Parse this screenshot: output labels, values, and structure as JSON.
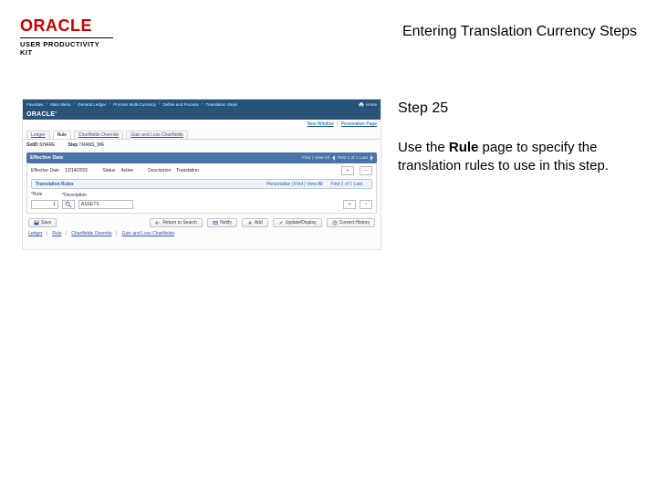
{
  "header": {
    "brand": "ORACLE",
    "subline": "USER PRODUCTIVITY KIT",
    "page_title": "Entering Translation Currency Steps"
  },
  "right": {
    "step_label": "Step 25",
    "text_before": "Use the ",
    "text_bold": "Rule",
    "text_after": " page to specify the translation rules to use in this step."
  },
  "ss": {
    "breadcrumb": {
      "items": [
        "Favorites",
        "Main Menu",
        "General Ledger",
        "Process Multi-Currency",
        "Define and Process",
        "Translation Steps"
      ],
      "home": "Home"
    },
    "oracle_bar": "ORACLE'",
    "top_links": {
      "left": "New Window",
      "right": "Personalize Page"
    },
    "tabs": {
      "t1": "Ledger",
      "t2": "Rule",
      "t3": "Chartfields Override",
      "t4": "Gain and Loss Chartfields"
    },
    "row1": {
      "setid_l": "SetID",
      "setid_v": "SHARE",
      "step_l": "Step",
      "step_v": "TRANS_WE"
    },
    "effbar": {
      "title": "Effective Date",
      "find_links": "Find | View All",
      "pager": "First  1 of 1  Last"
    },
    "eff": {
      "date_l": "Effective Date",
      "date_v": "12/14/2015",
      "status_l": "Status",
      "status_v": "Active",
      "desc_l": "Description",
      "desc_v": "Translation"
    },
    "trules": {
      "title": "Translation Rules",
      "find": "Personalize | Find | View All",
      "pager": "First  1 of 1  Last"
    },
    "cells": {
      "seq_h": "*Rule",
      "desc_h": "*Description",
      "seq_val": "1",
      "txt_val": "ASSETS"
    },
    "buttons": {
      "save": "Save",
      "return": "Return to Search",
      "notify": "Notify",
      "add": "Add",
      "update": "Update/Display",
      "correct": "Correct History"
    },
    "bottom_links": {
      "l1": "Ledger",
      "l2": "Rule",
      "l3": "Chartfields Override",
      "l4": "Gain and Loss Chartfields"
    }
  }
}
